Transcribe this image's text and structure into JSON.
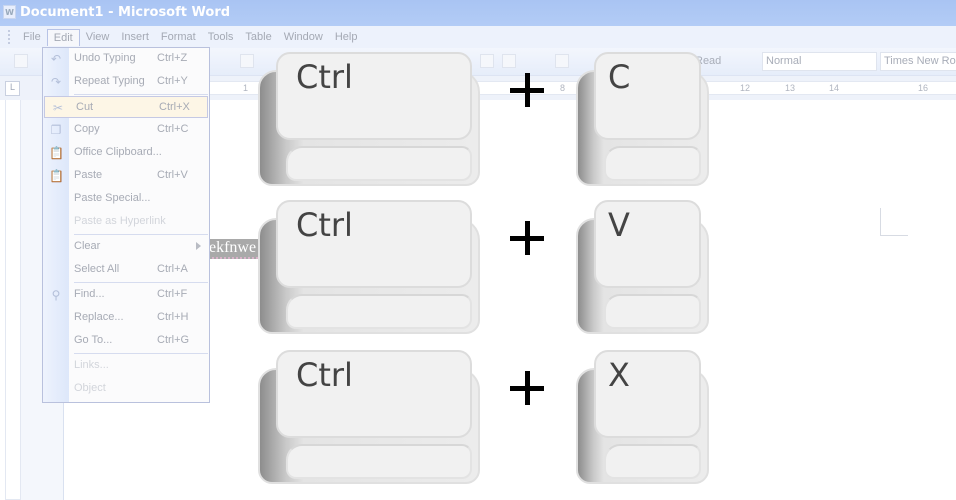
{
  "window": {
    "title": "Document1 - Microsoft Word",
    "app_icon": "word-icon"
  },
  "menubar": [
    "File",
    "Edit",
    "View",
    "Insert",
    "Format",
    "Tools",
    "Table",
    "Window",
    "Help"
  ],
  "toolbar": {
    "read_label": "Read",
    "style_value": "Normal",
    "font_value": "Times New Roman"
  },
  "ruler": {
    "numbers": [
      "1",
      "8",
      "12",
      "13",
      "14",
      "16"
    ]
  },
  "document": {
    "text": "ekfnwe"
  },
  "edit_menu": {
    "items": [
      {
        "label": "Undo Typing",
        "shortcut": "Ctrl+Z",
        "icon": "undo-icon"
      },
      {
        "label": "Repeat Typing",
        "shortcut": "Ctrl+Y",
        "icon": "redo-icon"
      },
      {
        "label": "Cut",
        "shortcut": "Ctrl+X",
        "icon": "scissors-icon",
        "highlighted": true
      },
      {
        "label": "Copy",
        "shortcut": "Ctrl+C",
        "icon": "copy-icon"
      },
      {
        "label": "Office Clipboard...",
        "shortcut": "",
        "icon": "clipboard-icon"
      },
      {
        "label": "Paste",
        "shortcut": "Ctrl+V",
        "icon": "paste-icon"
      },
      {
        "label": "Paste Special...",
        "shortcut": ""
      },
      {
        "label": "Paste as Hyperlink",
        "shortcut": "",
        "disabled": true
      },
      {
        "label": "Clear",
        "shortcut": "",
        "submenu": true
      },
      {
        "label": "Select All",
        "shortcut": "Ctrl+A"
      },
      {
        "label": "Find...",
        "shortcut": "Ctrl+F",
        "icon": "binoculars-icon"
      },
      {
        "label": "Replace...",
        "shortcut": "Ctrl+H"
      },
      {
        "label": "Go To...",
        "shortcut": "Ctrl+G"
      },
      {
        "label": "Links...",
        "shortcut": "",
        "disabled": true
      },
      {
        "label": "Object",
        "shortcut": "",
        "disabled": true
      }
    ]
  },
  "overlay": {
    "shortcuts": [
      {
        "modifier": "Ctrl",
        "key": "C"
      },
      {
        "modifier": "Ctrl",
        "key": "V"
      },
      {
        "modifier": "Ctrl",
        "key": "X"
      }
    ]
  }
}
